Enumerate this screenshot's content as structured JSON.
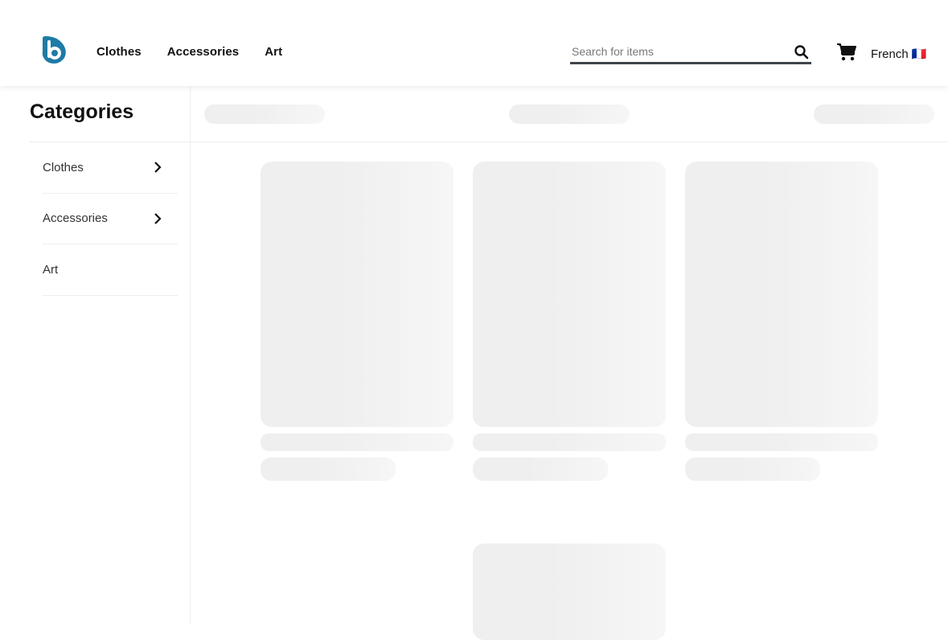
{
  "header": {
    "logo_name": "b-logo",
    "brand_color": "#1e7ba6",
    "nav": [
      "Clothes",
      "Accessories",
      "Art"
    ],
    "search": {
      "placeholder": "Search for items",
      "value": ""
    },
    "language": "French 🇫🇷"
  },
  "sidebar": {
    "title": "Categories",
    "items": [
      {
        "label": "Clothes",
        "has_children": true
      },
      {
        "label": "Accessories",
        "has_children": true
      },
      {
        "label": "Art",
        "has_children": false
      }
    ]
  },
  "main": {
    "state": "loading",
    "skeleton_color": "#efefef"
  }
}
